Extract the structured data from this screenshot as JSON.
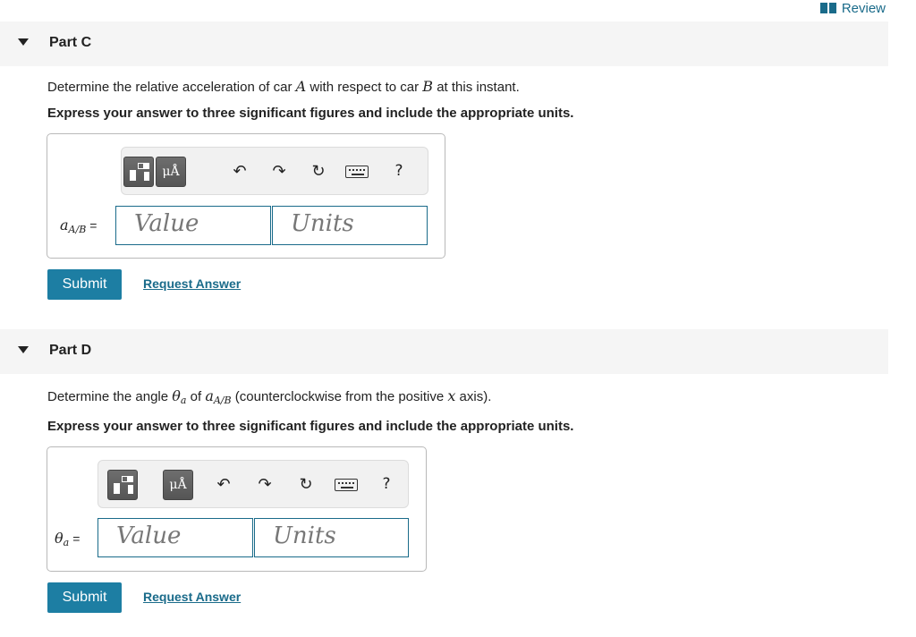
{
  "header": {
    "review_label": "Review"
  },
  "part_c": {
    "title": "Part C",
    "question_prefix": "Determine the relative acceleration of car ",
    "var_a": "A",
    "question_mid": " with respect to car ",
    "var_b": "B",
    "question_suffix": " at this instant.",
    "instruction": "Express your answer to three significant figures and include the appropriate units.",
    "label_main": "a",
    "label_sub": "A/B",
    "label_eq": "=",
    "value_placeholder": "Value",
    "units_placeholder": "Units",
    "toolbar": {
      "units_label": "μÅ",
      "help_label": "?"
    },
    "submit_label": "Submit",
    "request_label": "Request Answer"
  },
  "part_d": {
    "title": "Part D",
    "question_prefix": "Determine the angle ",
    "theta": "θ",
    "theta_sub": "a",
    "question_of": " of ",
    "a_var": "a",
    "a_sub": "A/B",
    "question_paren": " (counterclockwise from the positive ",
    "x_var": "x",
    "question_suffix": " axis).",
    "instruction": "Express your answer to three significant figures and include the appropriate units.",
    "label_main": "θ",
    "label_sub": "a",
    "label_eq": "=",
    "value_placeholder": "Value",
    "units_placeholder": "Units",
    "toolbar": {
      "units_label": "μÅ",
      "help_label": "?"
    },
    "submit_label": "Submit",
    "request_label": "Request Answer"
  },
  "icons": [
    "templates-icon",
    "units-icon",
    "undo-icon",
    "redo-icon",
    "reset-icon",
    "keyboard-icon",
    "help-icon",
    "review-book-icon",
    "collapse-triangle-icon"
  ],
  "colors": {
    "accent": "#1d7ea3",
    "link": "#1a6b8a",
    "header_bg": "#f5f5f5"
  }
}
